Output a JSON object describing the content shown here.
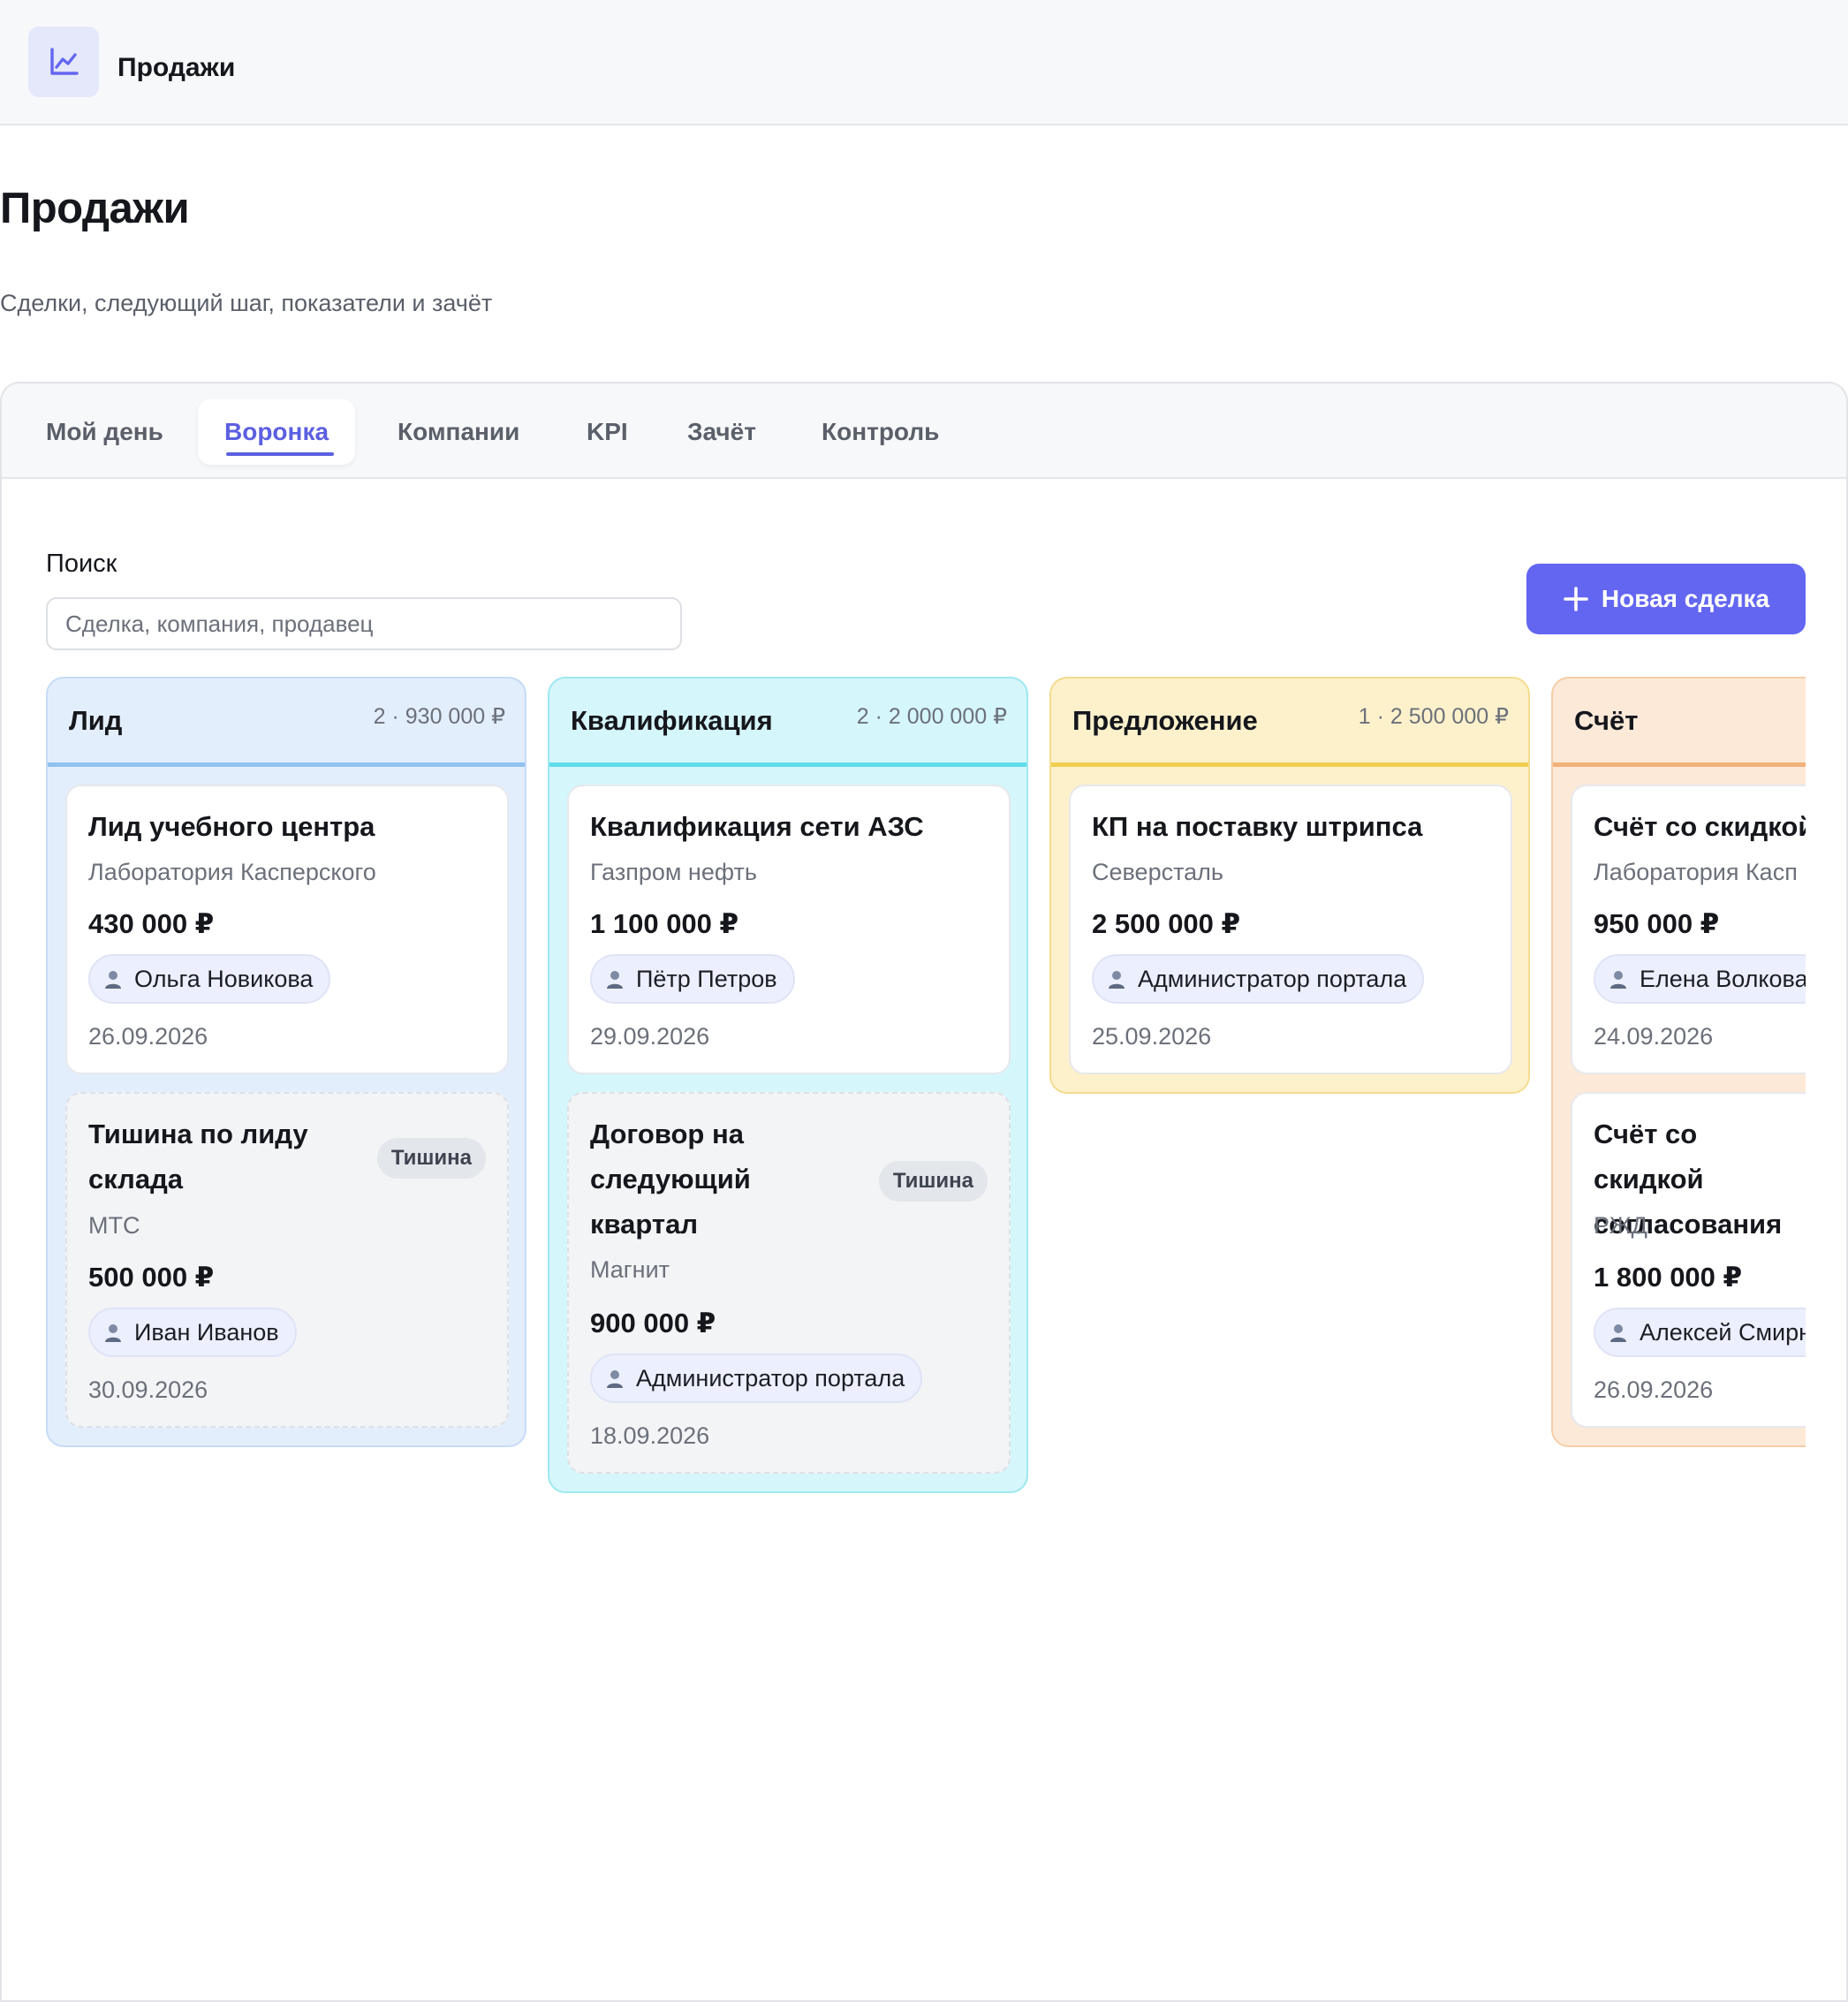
{
  "app": {
    "title": "Продажи",
    "icon": "chart-line-icon"
  },
  "page": {
    "title": "Продажи",
    "subtitle": "Сделки, следующий шаг, показатели и зачёт"
  },
  "tabs": [
    {
      "label": "Мой день"
    },
    {
      "label": "Воронка"
    },
    {
      "label": "Компании"
    },
    {
      "label": "KPI"
    },
    {
      "label": "Зачёт"
    },
    {
      "label": "Контроль"
    }
  ],
  "active_tab": "Воронка",
  "search": {
    "label": "Поиск",
    "placeholder": "Сделка, компания, продавец",
    "value": ""
  },
  "new_deal_button": {
    "label": "Новая сделка",
    "icon": "plus-icon"
  },
  "colors": {
    "accent": "#6366f1",
    "lead": "#e3eefd",
    "qualification": "#d5f6fa",
    "proposal": "#fdf1cc",
    "invoice": "#fde9d8"
  },
  "columns": [
    {
      "title": "Лид",
      "meta": "2 · 930 000 ₽",
      "cards": [
        {
          "title": "Лид учебного центра",
          "company": "Лаборатория Касперского",
          "amount": "430 000 ₽",
          "owner": "Ольга Новикова",
          "date": "26.09.2026"
        },
        {
          "title": "Тишина по лиду склада",
          "company": "МТС",
          "amount": "500 000 ₽",
          "owner": "Иван Иванов",
          "date": "30.09.2026",
          "badge": "Тишина"
        }
      ]
    },
    {
      "title": "Квалификация",
      "meta": "2 · 2 000 000 ₽",
      "cards": [
        {
          "title": "Квалификация сети АЗС",
          "company": "Газпром нефть",
          "amount": "1 100 000 ₽",
          "owner": "Пётр Петров",
          "date": "29.09.2026"
        },
        {
          "title": "Договор на следующий квартал",
          "company": "Магнит",
          "amount": "900 000 ₽",
          "owner": "Администратор портала",
          "date": "18.09.2026",
          "badge": "Тишина"
        }
      ]
    },
    {
      "title": "Предложение",
      "meta": "1 · 2 500 000 ₽",
      "cards": [
        {
          "title": "КП на поставку штрипса",
          "company": "Северсталь",
          "amount": "2 500 000 ₽",
          "owner": "Администратор портала",
          "date": "25.09.2026"
        }
      ]
    },
    {
      "title": "Счёт",
      "meta": "",
      "cards": [
        {
          "title": "Счёт со скидкой",
          "company": "Лаборатория Касп",
          "amount": "950 000 ₽",
          "owner": "Елена Волкова",
          "date": "24.09.2026"
        },
        {
          "title": "Счёт со скидкой согласования",
          "company": "РЖД",
          "amount": "1 800 000 ₽",
          "owner": "Алексей Смирн",
          "date": "26.09.2026"
        }
      ]
    }
  ]
}
